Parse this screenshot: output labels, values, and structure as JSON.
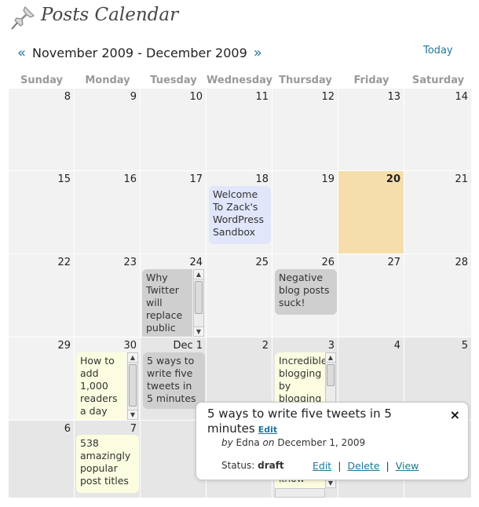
{
  "page": {
    "title": "Posts Calendar"
  },
  "nav": {
    "prev": "«",
    "next": "»",
    "range": "November 2009 - December 2009",
    "today": "Today"
  },
  "weekdays": [
    "Sunday",
    "Monday",
    "Tuesday",
    "Wednesday",
    "Thursday",
    "Friday",
    "Saturday"
  ],
  "days": [
    [
      "8",
      "9",
      "10",
      "11",
      "12",
      "13",
      "14"
    ],
    [
      "15",
      "16",
      "17",
      "18",
      "19",
      "20",
      "21"
    ],
    [
      "22",
      "23",
      "24",
      "25",
      "26",
      "27",
      "28"
    ],
    [
      "29",
      "30",
      "Dec 1",
      "2",
      "3",
      "4",
      "5"
    ],
    [
      "6",
      "7",
      "",
      "",
      "",
      "",
      ""
    ]
  ],
  "posts": {
    "welcome": "Welcome To Zack's WordPress Sandbox",
    "twitter": "Why Twitter will replace public",
    "negative": "Negative blog posts suck!",
    "readers": "How to add 1,000 readers a day",
    "tweets": "5 ways to write five tweets in 5 minutes",
    "blogging": "Incredible blogging by blogging",
    "know": "know",
    "titles": "538 amazingly popular post titles"
  },
  "popup": {
    "title": "5 ways to write five tweets in 5 minutes",
    "edit_link": "Edit",
    "close": "×",
    "by": "by",
    "author": "Edna",
    "on": "on",
    "date": "December 1, 2009",
    "status_label": "Status:",
    "status_value": "draft",
    "actions": {
      "edit": "Edit",
      "delete": "Delete",
      "view": "View",
      "sep": "|"
    }
  },
  "colors": {
    "link": "#21759b",
    "today": "#f6deac",
    "published": "#e1e6fb",
    "draft": "#cfcfcf",
    "scheduled": "#fcfce0"
  }
}
